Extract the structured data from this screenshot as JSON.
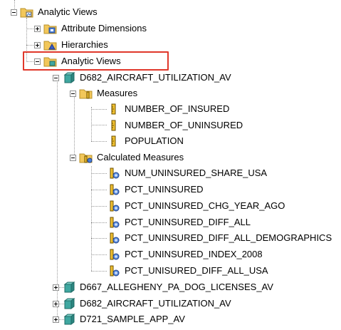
{
  "tree": {
    "root": {
      "label": "Analytic Views"
    },
    "attribute_dimensions": {
      "label": "Attribute Dimensions"
    },
    "hierarchies": {
      "label": "Hierarchies"
    },
    "analytic_views_folder": {
      "label": "Analytic Views"
    },
    "av_expanded": {
      "label": "D682_AIRCRAFT_UTILIZATION_AV",
      "measures": {
        "label": "Measures",
        "items": [
          "NUMBER_OF_INSURED",
          "NUMBER_OF_UNINSURED",
          "POPULATION"
        ]
      },
      "calculated_measures": {
        "label": "Calculated Measures",
        "items": [
          "NUM_UNINSURED_SHARE_USA",
          "PCT_UNINSURED",
          "PCT_UNINSURED_CHG_YEAR_AGO",
          "PCT_UNINSURED_DIFF_ALL",
          "PCT_UNINSURED_DIFF_ALL_DEMOGRAPHICS",
          "PCT_UNINSURED_INDEX_2008",
          "PCT_UNISURED_DIFF_ALL_USA"
        ]
      }
    },
    "collapsed_views": [
      "D667_ALLEGHENY_PA_DOG_LICENSES_AV",
      "D682_AIRCRAFT_UTILIZATION_AV",
      "D721_SAMPLE_APP_AV"
    ]
  },
  "colors": {
    "highlight_border": "#e0382b",
    "folder": "#f2c75a",
    "cube": "#3fa7a0",
    "measure": "#f0c030"
  }
}
